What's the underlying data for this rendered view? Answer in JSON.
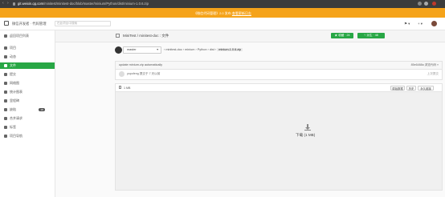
{
  "browser": {
    "url_host": "git.weixin.qq.com",
    "url_path": "/minitest/minitest-doc/blob/master/minium/Python/dist/minium-1.0.6.zip"
  },
  "banner": {
    "text": "《微信代码管理》2.0 发布",
    "link": "查看更新日志"
  },
  "topbar": {
    "brand": "微信开发者 · 代码管理",
    "search_placeholder": "在此项目中搜索",
    "plus_label": "+",
    "new_label": "▾"
  },
  "sidebar": {
    "items": [
      {
        "label": "返回项目列表"
      },
      {
        "label": "项目"
      },
      {
        "label": "动态"
      },
      {
        "label": "文件"
      },
      {
        "label": "提交"
      },
      {
        "label": "网络图"
      },
      {
        "label": "统计图表"
      },
      {
        "label": "里程碑"
      },
      {
        "label": "缺陷",
        "count": "18"
      },
      {
        "label": "合并请求"
      },
      {
        "label": "标签"
      },
      {
        "label": "项目导航"
      }
    ]
  },
  "repo": {
    "title": "MiniTest / minitest-doc : 文件",
    "watch_label": "★ 收藏 · 24",
    "fork_label": "⑂ 派生 · 48"
  },
  "branch": {
    "name": "master"
  },
  "breadcrumbs": {
    "path": "› minitest-doc › minium › Python › dist ›",
    "current": "minium-1.0.6.zip"
  },
  "commit": {
    "message": "update minium.zip automatically",
    "hash": "85e6488a  浏览代码 »",
    "user": "yopofeng 提交于 7 天以前",
    "right": "上次提交"
  },
  "file": {
    "size": "1 MB",
    "raw_label": "原始数据",
    "history_label": "历史",
    "blame_label": "永久链接"
  },
  "viewer": {
    "download_text": "下载 (1 MB)"
  }
}
